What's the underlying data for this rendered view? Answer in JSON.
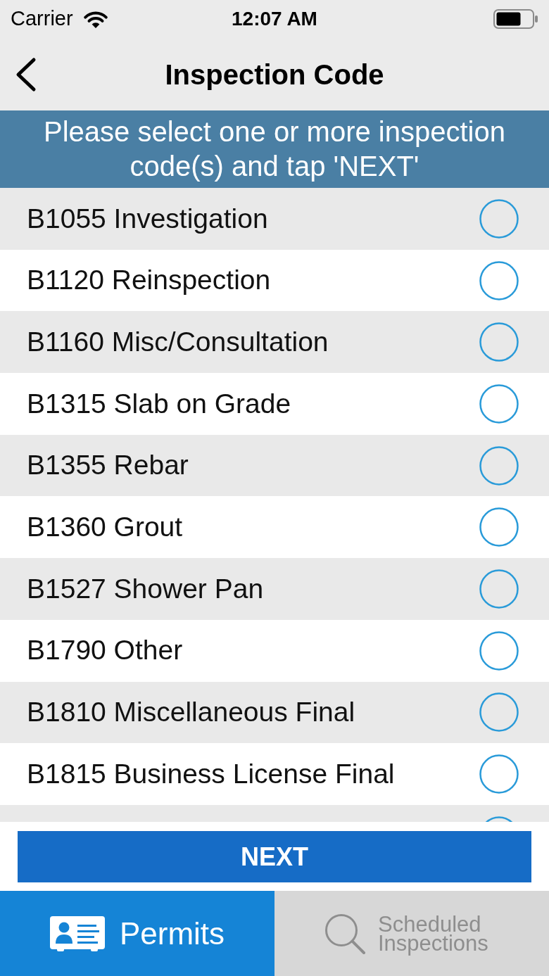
{
  "status_bar": {
    "carrier": "Carrier",
    "time": "12:07 AM"
  },
  "nav_bar": {
    "title": "Inspection Code"
  },
  "banner": {
    "text": "Please select one or more inspection code(s) and tap 'NEXT'"
  },
  "code_list": {
    "items": [
      {
        "label": "B1055 Investigation",
        "selected": false
      },
      {
        "label": "B1120 Reinspection",
        "selected": false
      },
      {
        "label": "B1160 Misc/Consultation",
        "selected": false
      },
      {
        "label": "B1315 Slab on Grade",
        "selected": false
      },
      {
        "label": "B1355 Rebar",
        "selected": false
      },
      {
        "label": "B1360 Grout",
        "selected": false
      },
      {
        "label": "B1527 Shower Pan",
        "selected": false
      },
      {
        "label": "B1790 Other",
        "selected": false
      },
      {
        "label": "B1810 Miscellaneous Final",
        "selected": false
      },
      {
        "label": "B1815 Business License Final",
        "selected": false
      }
    ],
    "more_below": true
  },
  "next_button": {
    "label": "NEXT"
  },
  "tab_bar": [
    {
      "kind": "card",
      "label": "Permits",
      "selected": true
    },
    {
      "kind": "search",
      "label": "Scheduled Inspections",
      "selected": false
    }
  ]
}
